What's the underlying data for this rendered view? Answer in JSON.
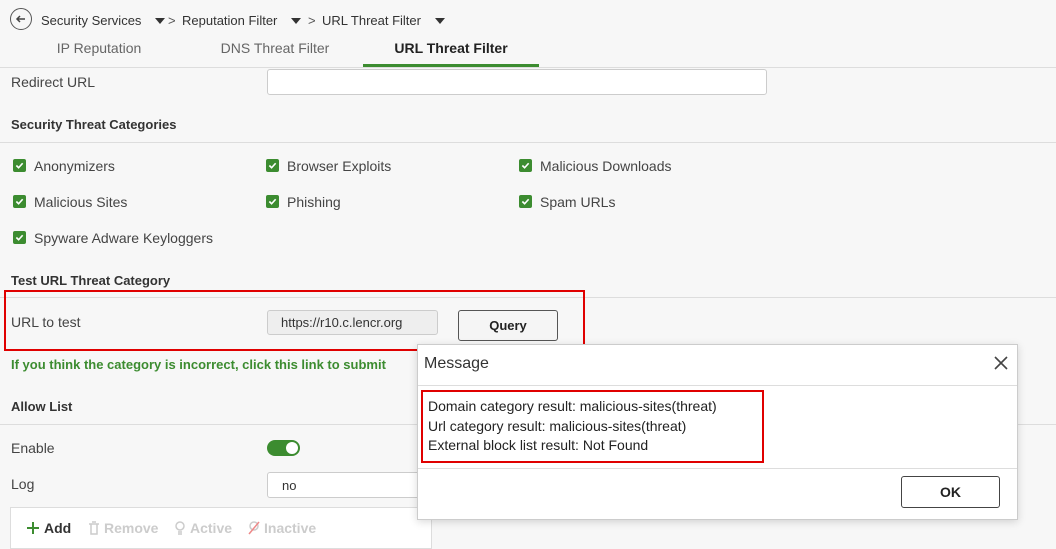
{
  "breadcrumb": {
    "items": [
      "Security Services",
      "Reputation Filter",
      "URL Threat Filter"
    ],
    "separator": ">"
  },
  "tabs": [
    {
      "label": "IP Reputation"
    },
    {
      "label": "DNS Threat Filter"
    },
    {
      "label": "URL Threat Filter",
      "active": true
    }
  ],
  "redirect": {
    "label": "Redirect URL",
    "value": ""
  },
  "threat_categories": {
    "title": "Security Threat Categories",
    "items": [
      {
        "label": "Anonymizers",
        "checked": true
      },
      {
        "label": "Browser Exploits",
        "checked": true
      },
      {
        "label": "Malicious Downloads",
        "checked": true
      },
      {
        "label": "Malicious Sites",
        "checked": true
      },
      {
        "label": "Phishing",
        "checked": true
      },
      {
        "label": "Spam URLs",
        "checked": true
      },
      {
        "label": "Spyware Adware Keyloggers",
        "checked": true
      }
    ]
  },
  "test_url": {
    "title": "Test URL Threat Category",
    "label": "URL to test",
    "value": "https://r10.c.lencr.org",
    "query_label": "Query",
    "submit_link": "If you think the category is incorrect, click this link to submit"
  },
  "allow_list": {
    "title": "Allow List",
    "enable_label": "Enable",
    "enable_on": true,
    "log_label": "Log",
    "log_value": "no",
    "toolbar": {
      "add": "Add",
      "remove": "Remove",
      "active": "Active",
      "inactive": "Inactive"
    }
  },
  "dialog": {
    "title": "Message",
    "lines": [
      "Domain category result: malicious-sites(threat)",
      "Url category result: malicious-sites(threat)",
      "External block list result: Not Found"
    ],
    "ok_label": "OK"
  },
  "colors": {
    "accent": "#3c8c30",
    "highlight": "#e00000"
  }
}
